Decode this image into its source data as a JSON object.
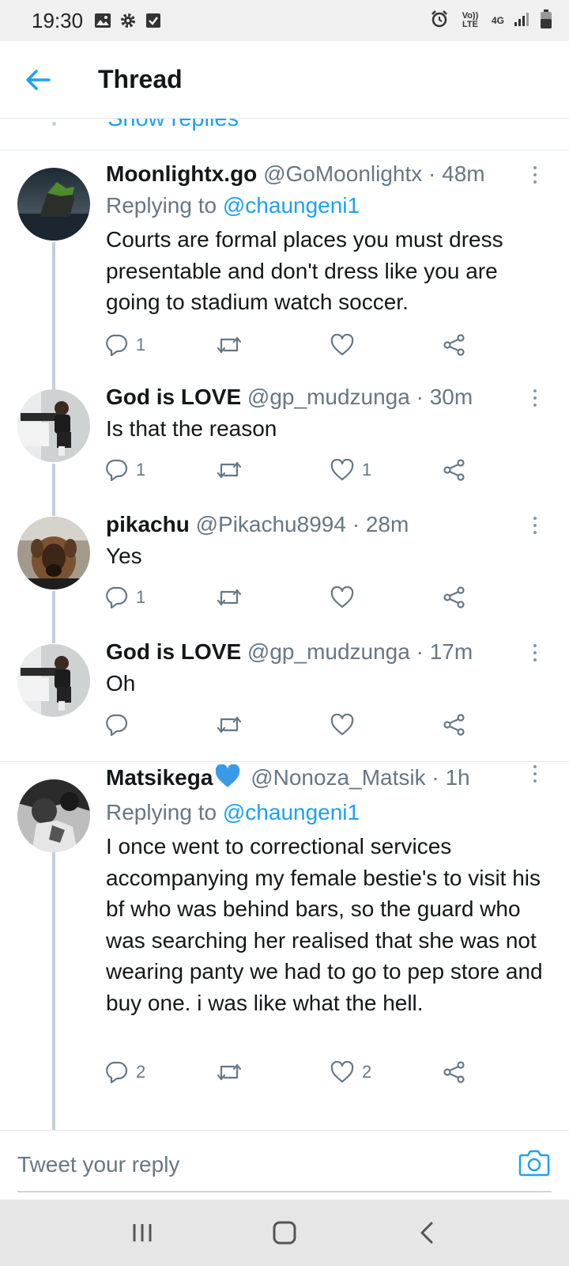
{
  "status_bar": {
    "time": "19:30",
    "network_top": "Vo)) LTE",
    "network_type": "4G"
  },
  "header": {
    "title": "Thread"
  },
  "show_replies": "Show replies",
  "tweets": [
    {
      "author": "Moonlightx.go",
      "handle": "@GoMoonlightx",
      "time": "48m",
      "replying_prefix": "Replying to",
      "replying_to": "@chaungeni1",
      "text": "Courts are formal places  you must dress presentable and don't dress like you are going to stadium watch soccer.",
      "replies": "1",
      "retweets": "",
      "likes": ""
    },
    {
      "author": "God is LOVE",
      "handle": "@gp_mudzunga",
      "time": "30m",
      "text": "Is that the reason",
      "replies": "1",
      "retweets": "",
      "likes": "1"
    },
    {
      "author": "pikachu",
      "handle": "@Pikachu8994",
      "time": "28m",
      "text": "Yes",
      "replies": "1",
      "retweets": "",
      "likes": ""
    },
    {
      "author": "God is LOVE",
      "handle": "@gp_mudzunga",
      "time": "17m",
      "text": "Oh",
      "replies": "",
      "retweets": "",
      "likes": ""
    },
    {
      "author": "Matsikega",
      "handle": "@Nonoza_Matsik",
      "time": "1h",
      "replying_prefix": "Replying to",
      "replying_to": "@chaungeni1",
      "text": "I once went to correctional services accompanying my female bestie's to visit his bf who was behind bars, so the guard who was searching her realised that she was not wearing panty we had to go to pep store and buy one. i was like what the hell.",
      "replies": "2",
      "retweets": "",
      "likes": "2"
    }
  ],
  "composer": {
    "placeholder": "Tweet your reply"
  },
  "colors": {
    "accent": "#1da1f2",
    "secondary_text": "#657786",
    "thread_line": "#c4cfd6",
    "status_bar": "#f0f0f0",
    "nav_bar": "#e6e6e6"
  }
}
